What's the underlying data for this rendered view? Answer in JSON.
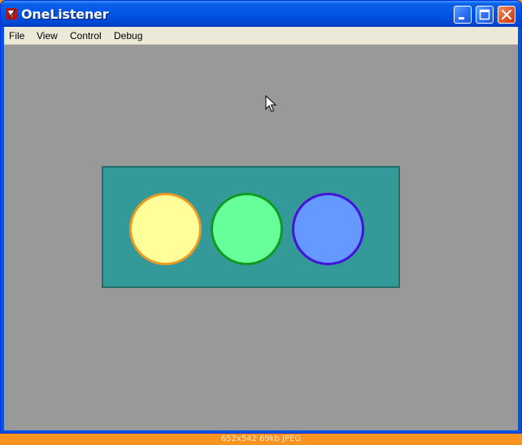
{
  "window": {
    "title": "OneListener",
    "title_color": "#ffffff"
  },
  "title_buttons": {
    "minimize": "minimize-icon",
    "maximize": "maximize-icon",
    "close": "close-icon"
  },
  "menu": {
    "items": [
      {
        "label": "File"
      },
      {
        "label": "View"
      },
      {
        "label": "Control"
      },
      {
        "label": "Debug"
      }
    ]
  },
  "canvas": {
    "background": "#999999",
    "panel": {
      "fill": "#339999",
      "border": "#246d6d",
      "circles": [
        {
          "name": "yellow-circle",
          "fill": "#ffff99",
          "stroke": "#ee9922"
        },
        {
          "name": "green-circle",
          "fill": "#66ff99",
          "stroke": "#119922"
        },
        {
          "name": "blue-circle",
          "fill": "#6699ff",
          "stroke": "#4411dd"
        }
      ]
    }
  },
  "status": {
    "text": "652x542  69kb  JPEG"
  }
}
